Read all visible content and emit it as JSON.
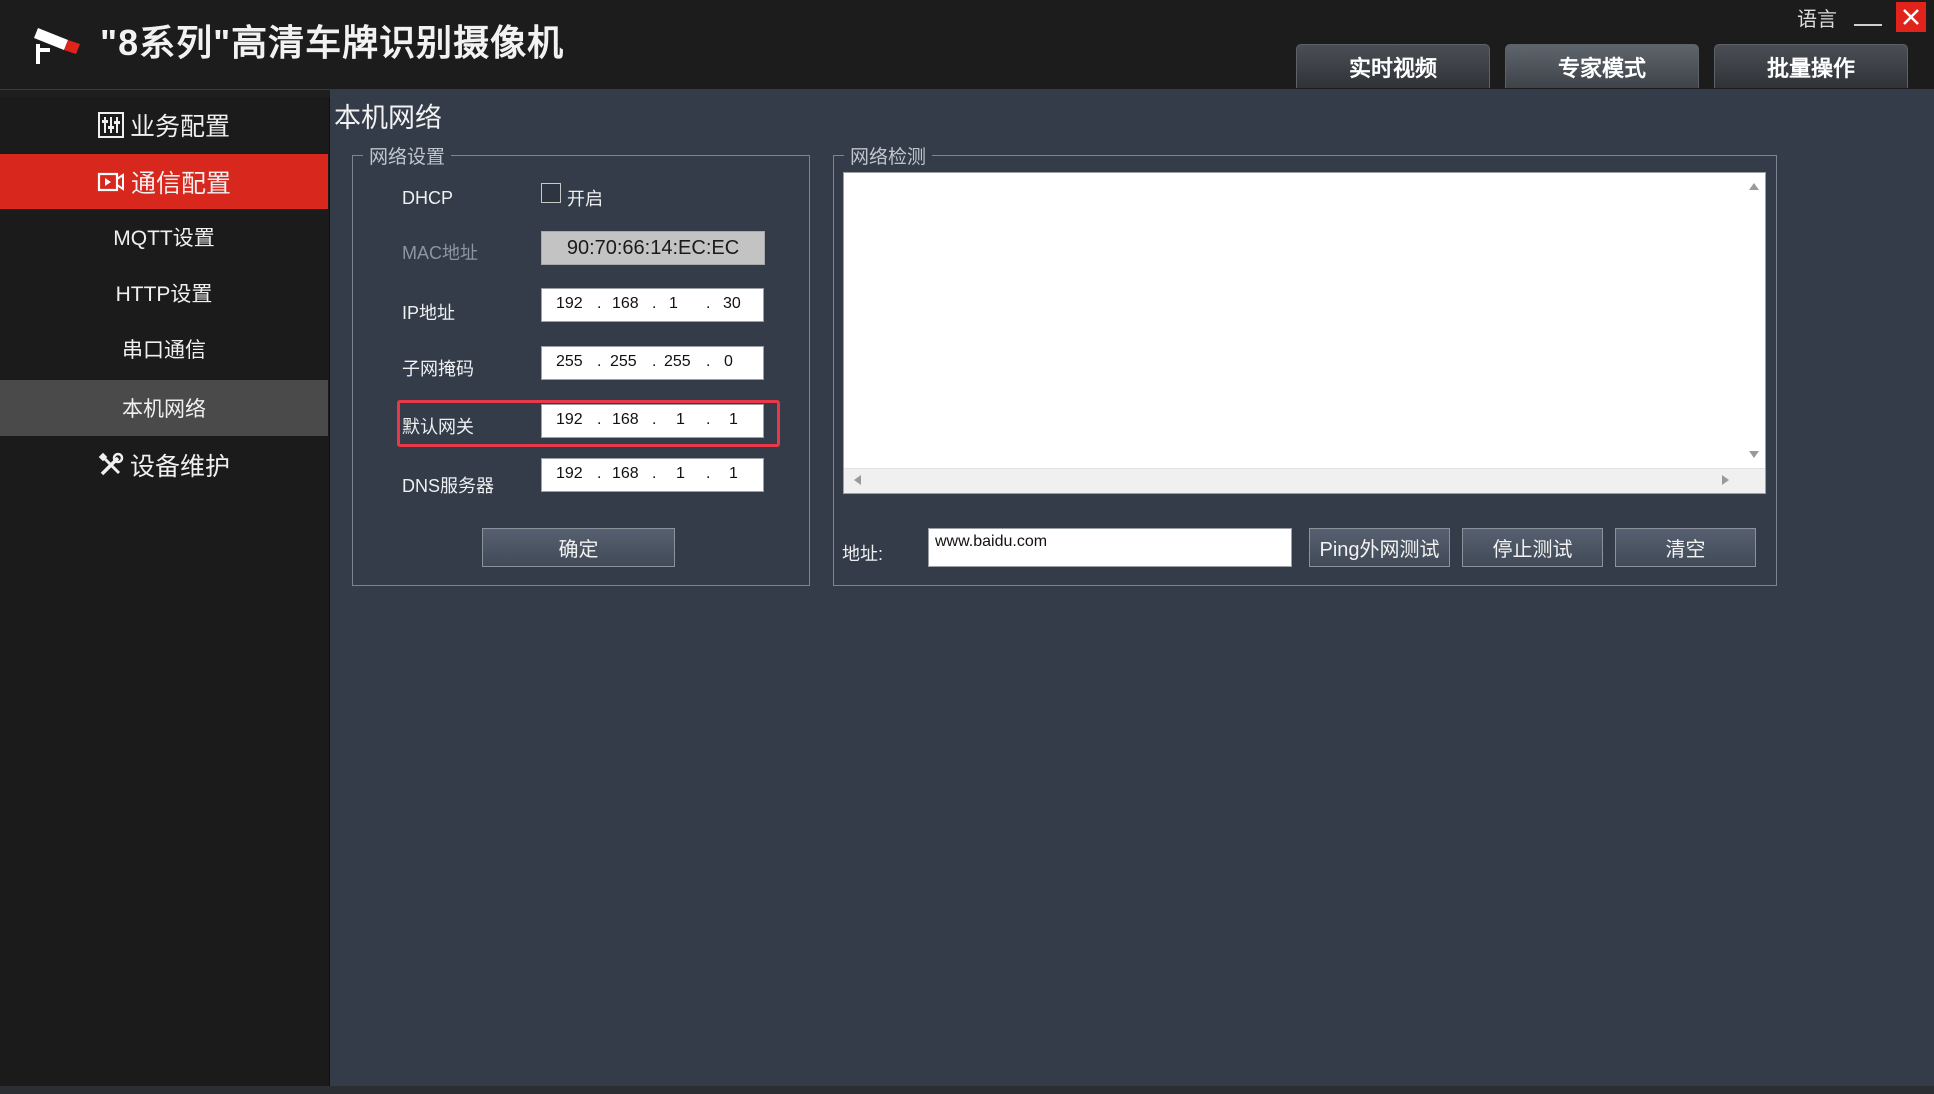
{
  "header": {
    "title": "\"8系列\"高清车牌识别摄像机",
    "language_label": "语言",
    "tabs": [
      {
        "label": "实时视频"
      },
      {
        "label": "专家模式"
      },
      {
        "label": "批量操作"
      }
    ]
  },
  "sidebar": {
    "groups": [
      {
        "label": "业务配置",
        "icon": "sliders-icon"
      },
      {
        "label": "通信配置",
        "icon": "camera-icon",
        "active": true
      },
      {
        "label": "设备维护",
        "icon": "tools-icon"
      }
    ],
    "items": [
      {
        "label": "MQTT设置"
      },
      {
        "label": "HTTP设置"
      },
      {
        "label": "串口通信"
      },
      {
        "label": "本机网络",
        "selected": true
      }
    ]
  },
  "page": {
    "title": "本机网络"
  },
  "network_settings": {
    "legend": "网络设置",
    "dhcp_label": "DHCP",
    "dhcp_option_label": "开启",
    "dhcp_checked": false,
    "mac_label": "MAC地址",
    "mac_value": "90:70:66:14:EC:EC",
    "ip_label": "IP地址",
    "ip": [
      "192",
      "168",
      "1",
      "30"
    ],
    "subnet_label": "子网掩码",
    "subnet": [
      "255",
      "255",
      "255",
      "0"
    ],
    "gateway_label": "默认网关",
    "gateway": [
      "192",
      "168",
      "1",
      "1"
    ],
    "dns_label": "DNS服务器",
    "dns": [
      "192",
      "168",
      "1",
      "1"
    ],
    "confirm_label": "确定"
  },
  "network_test": {
    "legend": "网络检测",
    "address_label": "地址:",
    "address_value": "www.baidu.com",
    "ping_label": "Ping外网测试",
    "stop_label": "停止测试",
    "clear_label": "清空"
  },
  "colors": {
    "accent_red": "#d8281e",
    "highlight_border": "#e8394a",
    "main_bg": "#333c48",
    "sidebar_bg": "#1b1b1b"
  }
}
